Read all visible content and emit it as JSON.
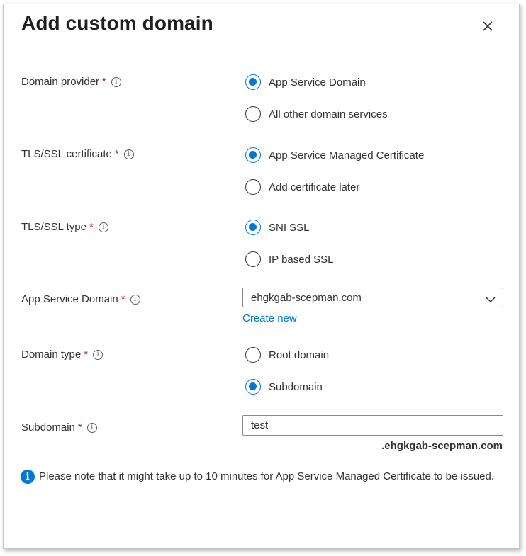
{
  "dialog": {
    "title": "Add custom domain",
    "close_icon": "close-icon"
  },
  "fields": {
    "domain_provider": {
      "label": "Domain provider",
      "required_mark": "*",
      "options": [
        "App Service Domain",
        "All other domain services"
      ],
      "selected": "App Service Domain"
    },
    "tls_certificate": {
      "label": "TLS/SSL certificate",
      "required_mark": "*",
      "options": [
        "App Service Managed Certificate",
        "Add certificate later"
      ],
      "selected": "App Service Managed Certificate"
    },
    "tls_type": {
      "label": "TLS/SSL type",
      "required_mark": "*",
      "options": [
        "SNI SSL",
        "IP based SSL"
      ],
      "selected": "SNI SSL"
    },
    "app_service_domain": {
      "label": "App Service Domain",
      "required_mark": "*",
      "value": "ehgkgab-scepman.com",
      "create_new_label": "Create new"
    },
    "domain_type": {
      "label": "Domain type",
      "required_mark": "*",
      "options": [
        "Root domain",
        "Subdomain"
      ],
      "selected": "Subdomain"
    },
    "subdomain": {
      "label": "Subdomain",
      "required_mark": "*",
      "value": "test",
      "suffix": ".ehgkgab-scepman.com"
    }
  },
  "note": {
    "text": "Please note that it might take up to 10 minutes for App Service Managed Certificate to be issued."
  },
  "colors": {
    "accent": "#0078d4",
    "required": "#a4262c",
    "text": "#323130"
  }
}
